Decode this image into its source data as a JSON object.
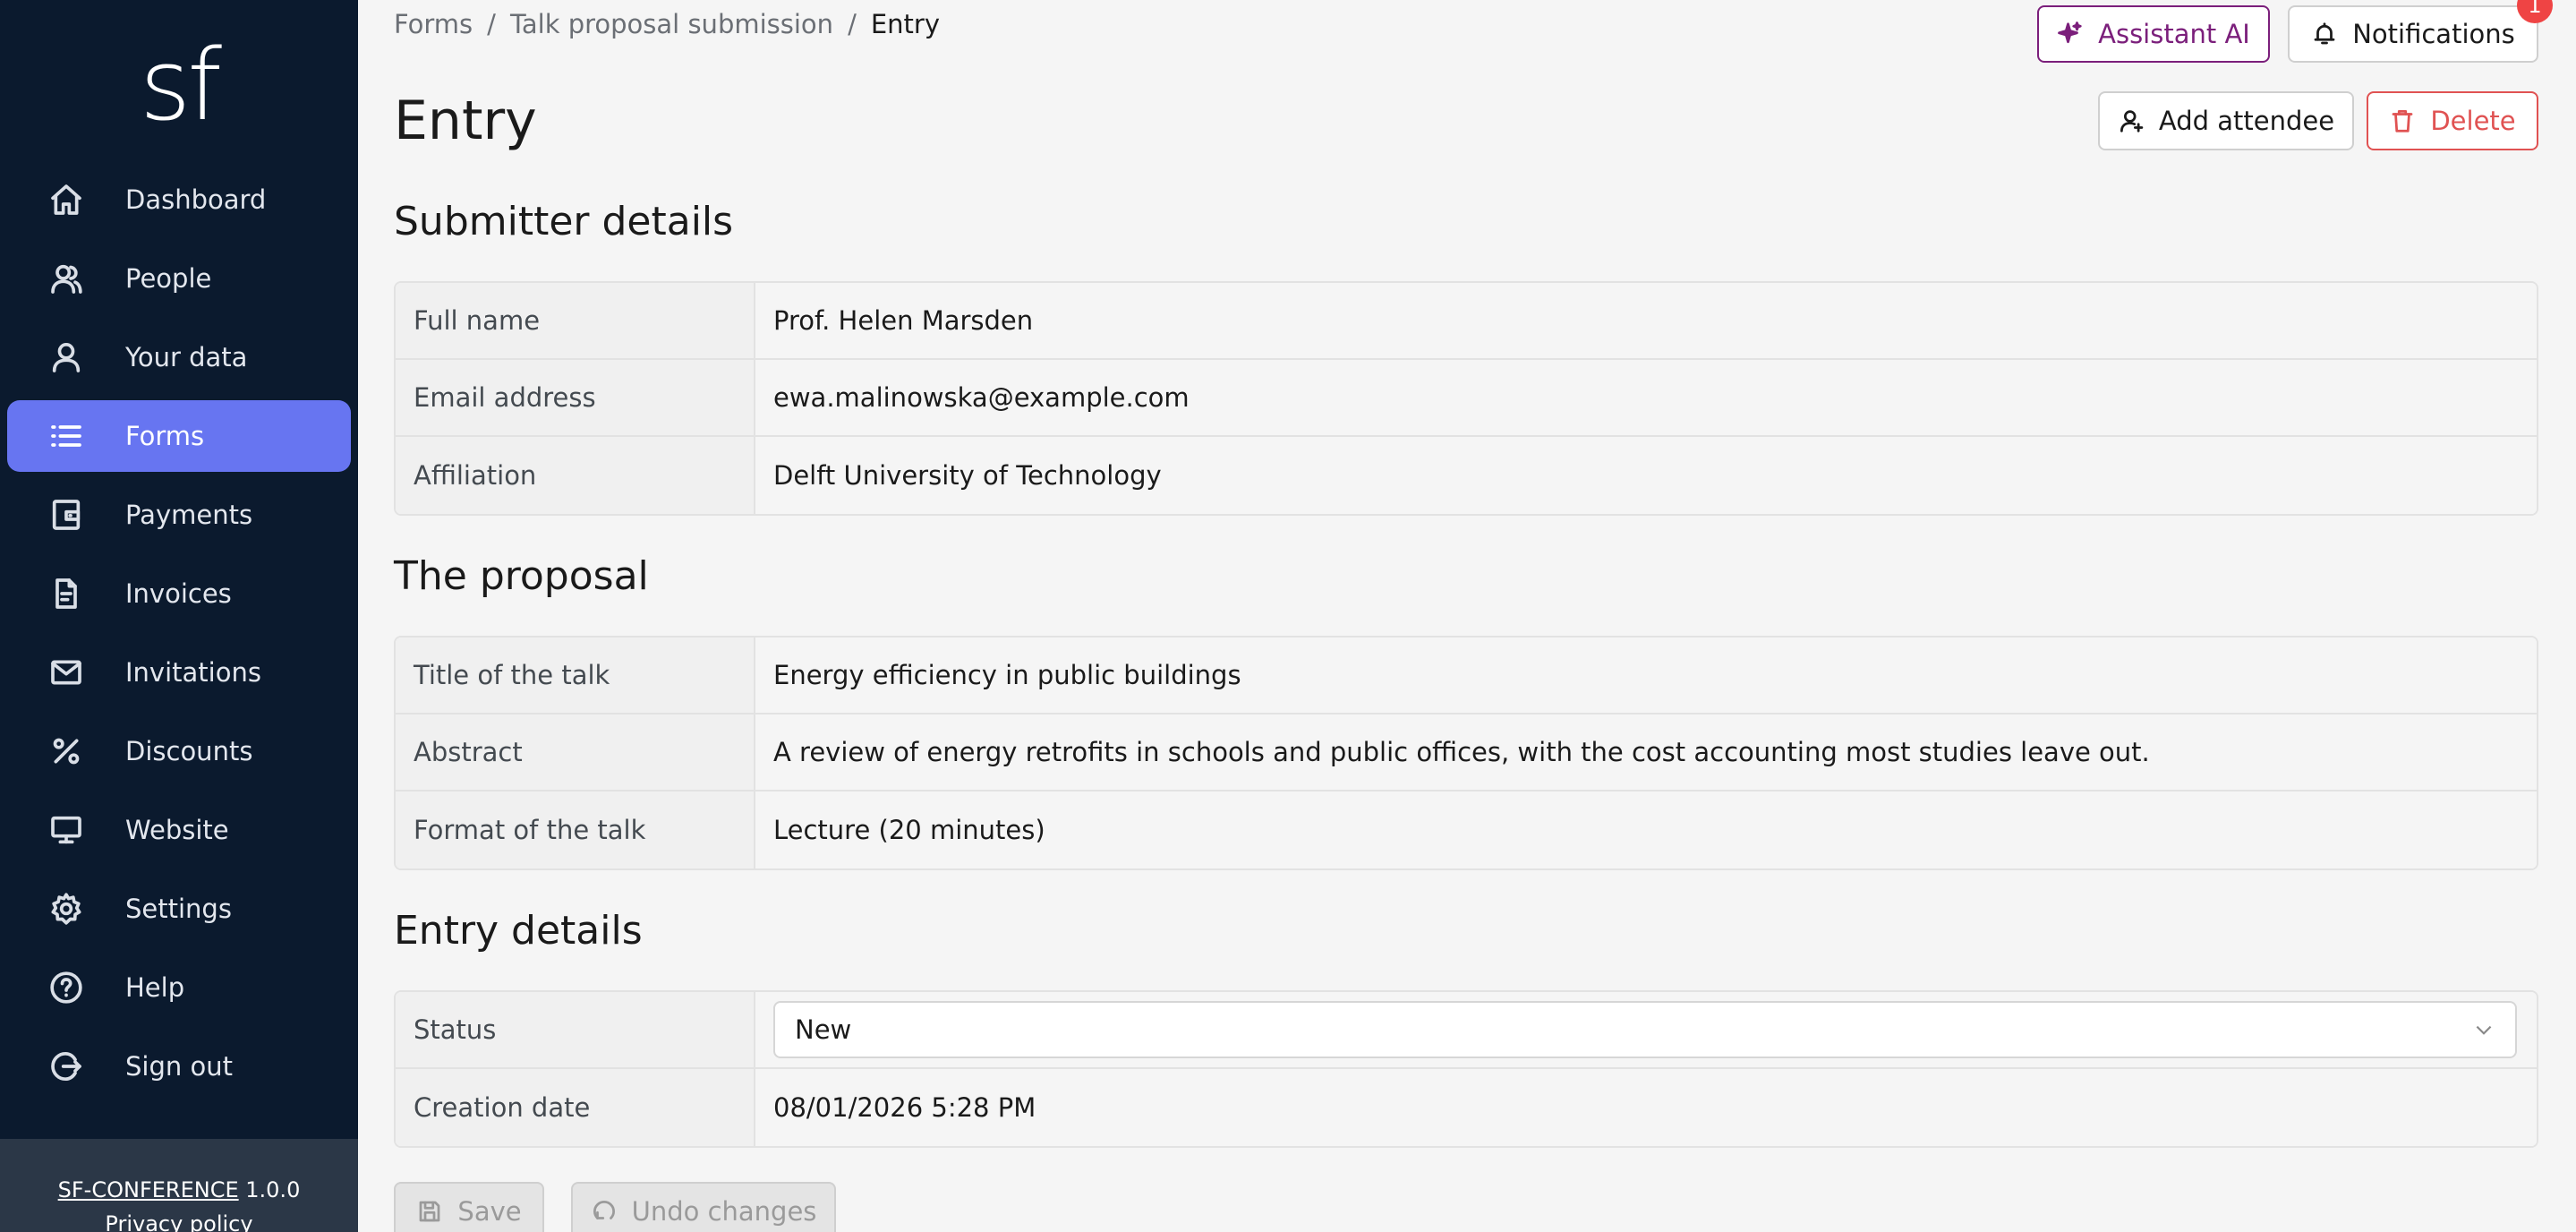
{
  "app": {
    "logo_text": "sf"
  },
  "sidebar": {
    "items": [
      {
        "label": "Dashboard",
        "icon": "home-icon"
      },
      {
        "label": "People",
        "icon": "people-icon"
      },
      {
        "label": "Your data",
        "icon": "user-icon"
      },
      {
        "label": "Forms",
        "icon": "list-icon",
        "active": true
      },
      {
        "label": "Payments",
        "icon": "wallet-icon"
      },
      {
        "label": "Invoices",
        "icon": "document-icon"
      },
      {
        "label": "Invitations",
        "icon": "mail-icon"
      },
      {
        "label": "Discounts",
        "icon": "percent-icon"
      },
      {
        "label": "Website",
        "icon": "monitor-icon"
      },
      {
        "label": "Settings",
        "icon": "gear-icon"
      },
      {
        "label": "Help",
        "icon": "help-icon"
      },
      {
        "label": "Sign out",
        "icon": "sign-out-icon"
      }
    ],
    "footer": {
      "product": "SF-CONFERENCE",
      "version": "1.0.0",
      "privacy": "Privacy policy"
    }
  },
  "breadcrumb": {
    "items": [
      "Forms",
      "Talk proposal submission",
      "Entry"
    ],
    "separator": "/"
  },
  "page": {
    "title": "Entry"
  },
  "toolbar": {
    "assistant_label": "Assistant AI",
    "notifications_label": "Notifications",
    "notifications_count": "1",
    "add_attendee_label": "Add attendee",
    "delete_label": "Delete"
  },
  "sections": {
    "submitter": {
      "title": "Submitter details",
      "rows": [
        {
          "label": "Full name",
          "value": "Prof. Helen Marsden"
        },
        {
          "label": "Email address",
          "value": "ewa.malinowska@example.com"
        },
        {
          "label": "Affiliation",
          "value": "Delft University of Technology"
        }
      ]
    },
    "proposal": {
      "title": "The proposal",
      "rows": [
        {
          "label": "Title of the talk",
          "value": "Energy efficiency in public buildings"
        },
        {
          "label": "Abstract",
          "value": "A review of energy retrofits in schools and public offices, with the cost accounting most studies leave out."
        },
        {
          "label": "Format of the talk",
          "value": "Lecture (20 minutes)"
        }
      ]
    },
    "entry": {
      "title": "Entry details",
      "status_label": "Status",
      "status_value": "New",
      "creation_label": "Creation date",
      "creation_value": "08/01/2026 5:28 PM"
    }
  },
  "actions": {
    "save_label": "Save",
    "undo_label": "Undo changes"
  },
  "colors": {
    "sidebar_bg": "#0b1a2e",
    "accent": "#6775f1",
    "assistant": "#7b1f7b",
    "danger": "#e05252",
    "badge": "#ef4444"
  }
}
